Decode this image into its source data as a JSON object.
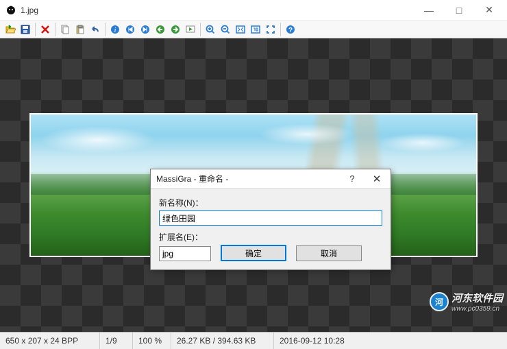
{
  "window": {
    "title": "1.jpg",
    "minimize": "—",
    "maximize": "□",
    "close": "✕"
  },
  "toolbar": {
    "open": "open",
    "save": "save",
    "delete": "delete",
    "copy": "copy",
    "paste": "paste",
    "undo": "undo",
    "info": "info",
    "first": "first",
    "last": "last",
    "prev": "prev",
    "next": "next",
    "slideshow": "slideshow",
    "zoom_in": "zoom-in",
    "zoom_out": "zoom-out",
    "fit": "fit",
    "actual": "actual",
    "fullscreen": "fullscreen",
    "help": "help"
  },
  "dialog": {
    "title": "MassiGra - 重命名 -",
    "help": "?",
    "close": "✕",
    "name_label": "新名称(N)：",
    "name_value": "绿色田园",
    "ext_label": "扩展名(E)：",
    "ext_value": "jpg",
    "ok": "确定",
    "cancel": "取消"
  },
  "status": {
    "dimensions": "650 x 207 x 24 BPP",
    "index": "1/9",
    "zoom": "100 %",
    "size": "26.27 KB / 394.63 KB",
    "datetime": "2016-09-12 10:28"
  },
  "watermark": {
    "text": "河东软件园",
    "url": "www.pc0359.cn"
  }
}
